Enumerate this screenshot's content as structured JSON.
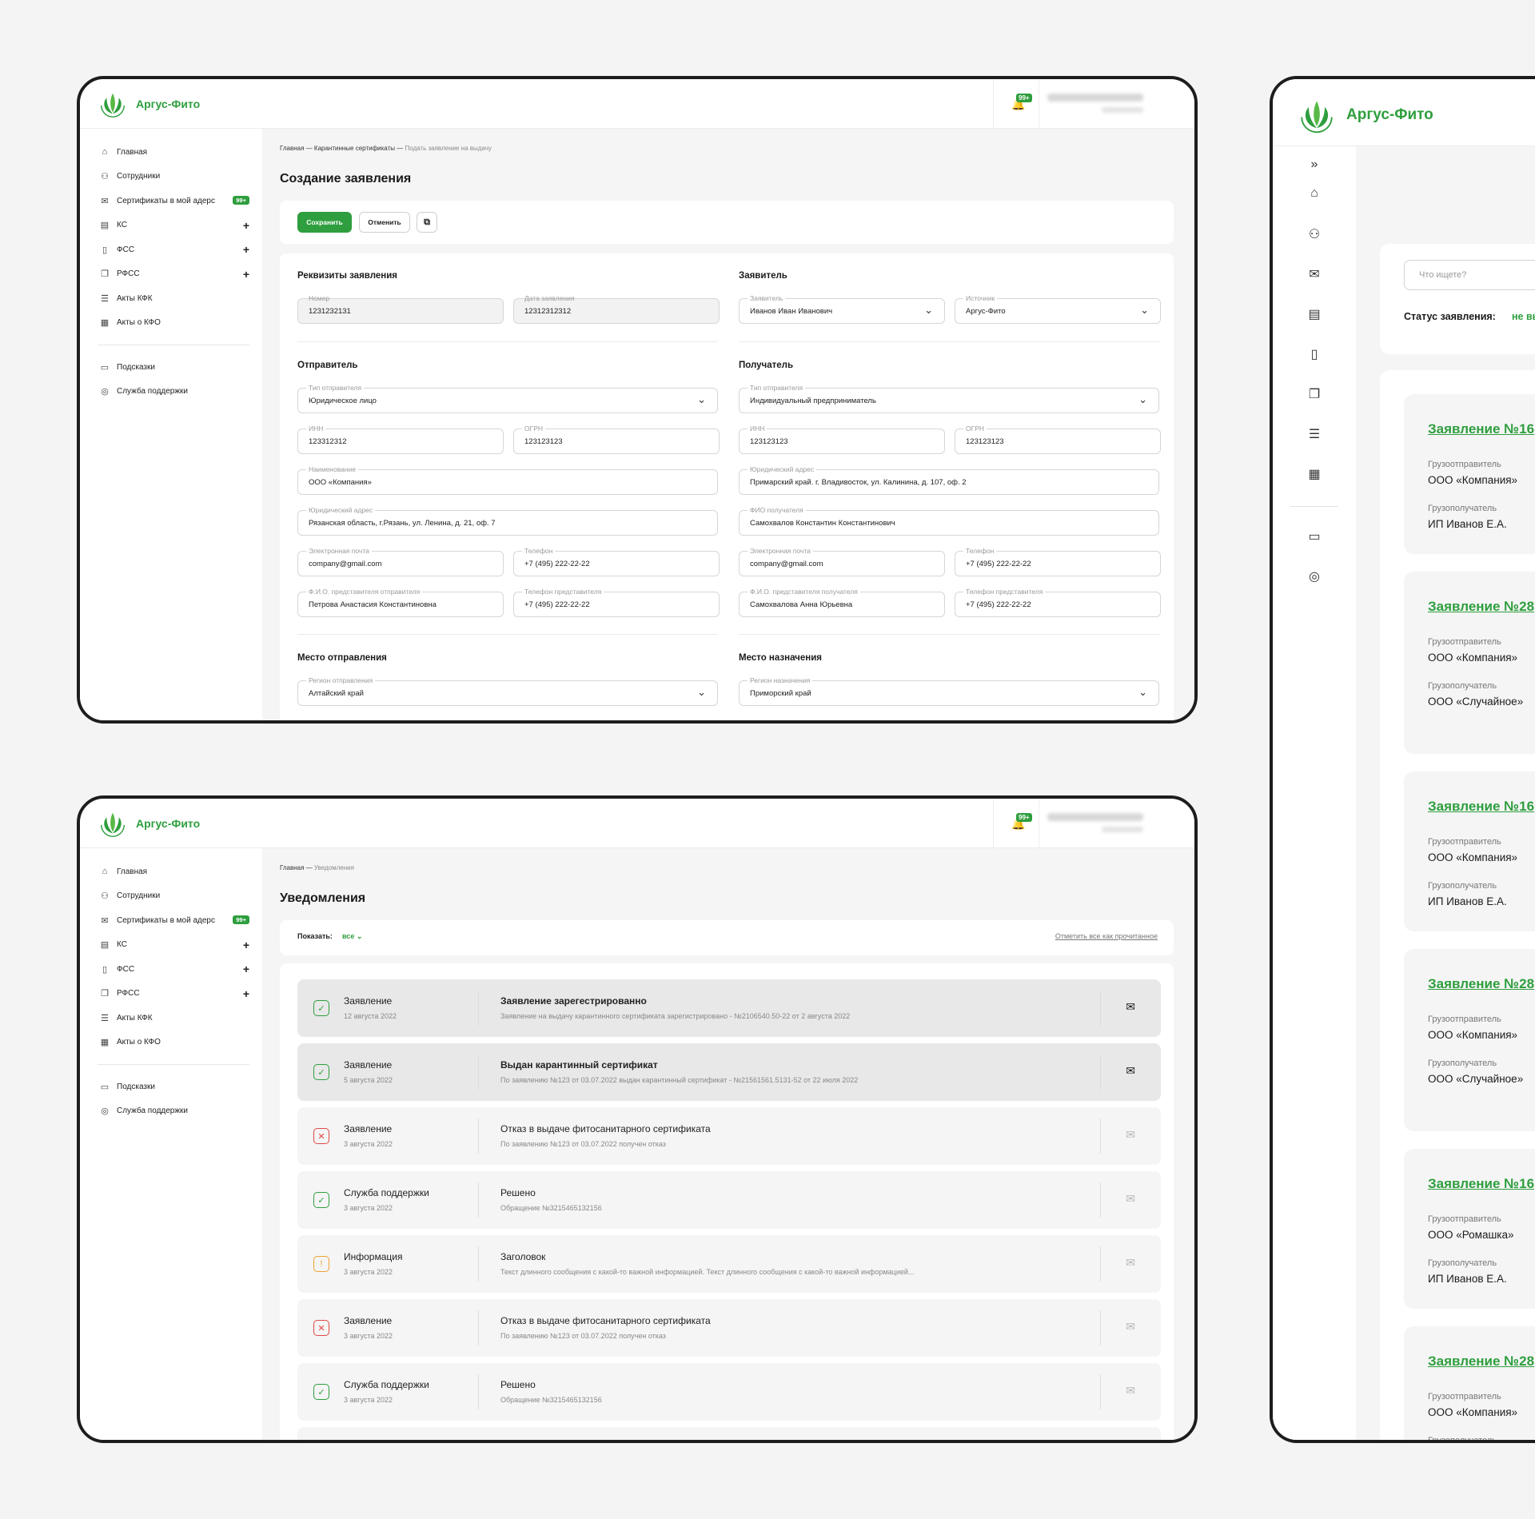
{
  "brand": {
    "name": "Аргус-Фито",
    "accent": "#2e9e3e"
  },
  "header": {
    "notifications_badge": "99+"
  },
  "sidebar": {
    "items": [
      {
        "label": "Главная",
        "icon": "home-icon"
      },
      {
        "label": "Сотрудники",
        "icon": "users-icon"
      },
      {
        "label": "Сертификаты в мой адерс",
        "icon": "mail-icon",
        "badge": "99+"
      },
      {
        "label": "КС",
        "icon": "document-icon",
        "expandable": true
      },
      {
        "label": "ФСС",
        "icon": "file-icon",
        "expandable": true
      },
      {
        "label": "РФСС",
        "icon": "files-icon",
        "expandable": true
      },
      {
        "label": "Акты КФК",
        "icon": "list-icon"
      },
      {
        "label": "Акты о КФО",
        "icon": "report-icon"
      }
    ],
    "bottom_items": [
      {
        "label": "Подсказки",
        "icon": "chat-icon"
      },
      {
        "label": "Служба поддержки",
        "icon": "support-icon"
      }
    ]
  },
  "form_screen": {
    "breadcrumbs": [
      "Главная",
      "Карантинные сертификаты",
      "Подать заявление на выдачу"
    ],
    "title": "Создание заявления",
    "actions": {
      "save": "Сохранить",
      "cancel": "Отменить"
    },
    "sections": {
      "requisites": "Реквизиты заявления",
      "applicant": "Заявитель",
      "sender": "Отправитель",
      "recipient": "Получатель",
      "departure": "Место отправления",
      "destination": "Место назначения"
    },
    "fields": {
      "number": {
        "label": "Номер",
        "value": "1231232131"
      },
      "date": {
        "label": "Дата заявления",
        "value": "12312312312"
      },
      "applicant": {
        "label": "Заявитель",
        "value": "Иванов Иван Иванович"
      },
      "source": {
        "label": "Источник",
        "value": "Аргус-Фито"
      },
      "sender_type": {
        "label": "Тип отправителя",
        "value": "Юридическое лицо"
      },
      "sender_inn": {
        "label": "ИНН",
        "value": "123312312"
      },
      "sender_ogrn": {
        "label": "ОГРН",
        "value": "123123123"
      },
      "sender_name": {
        "label": "Наименование",
        "value": "ООО «Компания»"
      },
      "sender_address": {
        "label": "Юридический адрес",
        "value": "Рязанская область, г.Рязань, ул. Ленина, д. 21, оф. 7"
      },
      "sender_email": {
        "label": "Электронная почта",
        "value": "company@gmail.com"
      },
      "sender_phone": {
        "label": "Телефон",
        "value": "+7 (495) 222-22-22"
      },
      "sender_rep": {
        "label": "Ф.И.О. представителя отправителя",
        "value": "Петрова Анастасия Константиновна"
      },
      "sender_rep_phone": {
        "label": "Телефон представителя",
        "value": "+7 (495) 222-22-22"
      },
      "recipient_type": {
        "label": "Тип отправителя",
        "value": "Индивидуальный предприниматель"
      },
      "recipient_inn": {
        "label": "ИНН",
        "value": "123123123"
      },
      "recipient_ogrn": {
        "label": "ОГРН",
        "value": "123123123"
      },
      "recipient_address": {
        "label": "Юридический адрес",
        "value": "Примарский край. г. Владивосток, ул. Калинина, д. 107, оф. 2"
      },
      "recipient_fio": {
        "label": "ФИО получателя",
        "value": "Самохвалов Константин Константинович"
      },
      "recipient_email": {
        "label": "Электронная почта",
        "value": "company@gmail.com"
      },
      "recipient_phone": {
        "label": "Телефон",
        "value": "+7 (495) 222-22-22"
      },
      "recipient_rep": {
        "label": "Ф.И.О. представителя получателя",
        "value": "Самохвалова Анна Юрьевна"
      },
      "recipient_rep_phone": {
        "label": "Телефон представителя",
        "value": "+7 (495) 222-22-22"
      },
      "departure_region": {
        "label": "Регион отправления",
        "value": "Алтайский край"
      },
      "destination_region": {
        "label": "Регион назначения",
        "value": "Приморский край"
      }
    }
  },
  "notifications_screen": {
    "breadcrumbs": [
      "Главная",
      "Уведомления"
    ],
    "title": "Уведомления",
    "filter_label": "Показать:",
    "filter_value": "все",
    "mark_all": "Отметить все как прочитанное",
    "items": [
      {
        "status": "ok",
        "unread": true,
        "type": "Заявление",
        "date": "12 августа 2022",
        "title": "Заявление зарегестрированно",
        "desc": "Заявление на выдачу карантинного сертификата зарегистрировано - №2106540.50-22 от 2 августа 2022"
      },
      {
        "status": "ok",
        "unread": true,
        "type": "Заявление",
        "date": "5 августа 2022",
        "title": "Выдан карантинный сертификат",
        "desc": "По заявлению №123  от 03.07.2022 выдан карантинный сертификат - №21561561.5131-52 от 22 июля 2022"
      },
      {
        "status": "error",
        "unread": false,
        "type": "Заявление",
        "date": "3 августа 2022",
        "title": "Отказ в выдаче фитосанитарного сертификата",
        "desc": "По заявлению №123  от 03.07.2022 получен отказ"
      },
      {
        "status": "ok",
        "unread": false,
        "type": "Служба поддержки",
        "date": "3 августа 2022",
        "title": "Решено",
        "desc": "Обращение №3215465132156"
      },
      {
        "status": "warn",
        "unread": false,
        "type": "Информация",
        "date": "3 августа 2022",
        "title": "Заголовок",
        "desc": "Текст длинного сообщения с какой-то важной информацией. Текст длинного сообщения с какой-то важной информацией..."
      },
      {
        "status": "error",
        "unread": false,
        "type": "Заявление",
        "date": "3 августа 2022",
        "title": "Отказ в выдаче фитосанитарного сертификата",
        "desc": "По заявлению №123  от 03.07.2022 получен отказ"
      },
      {
        "status": "ok",
        "unread": false,
        "type": "Служба поддержки",
        "date": "3 августа 2022",
        "title": "Решено",
        "desc": "Обращение №3215465132156"
      }
    ]
  },
  "list_screen": {
    "search_placeholder": "Что ищете?",
    "status_label": "Статус заявления:",
    "status_value": "не вы",
    "shipper_label": "Грузоотправитель",
    "consignee_label": "Грузополучатель",
    "applications": [
      {
        "title": "Заявление №16",
        "shipper": "ООО «Компания»",
        "consignee": "ИП Иванов Е.А."
      },
      {
        "title": "Заявление №28",
        "shipper": "ООО «Компания»",
        "consignee": "ООО «Случайное»"
      },
      {
        "title": "Заявление №16",
        "shipper": "ООО «Компания»",
        "consignee": "ИП Иванов Е.А."
      },
      {
        "title": "Заявление №28",
        "shipper": "ООО «Компания»",
        "consignee": "ООО «Случайное»"
      },
      {
        "title": "Заявление №16",
        "shipper": "ООО «Ромашка»",
        "consignee": "ИП Иванов Е.А."
      },
      {
        "title": "Заявление №28",
        "shipper": "ООО «Компания»",
        "consignee": ""
      }
    ]
  }
}
